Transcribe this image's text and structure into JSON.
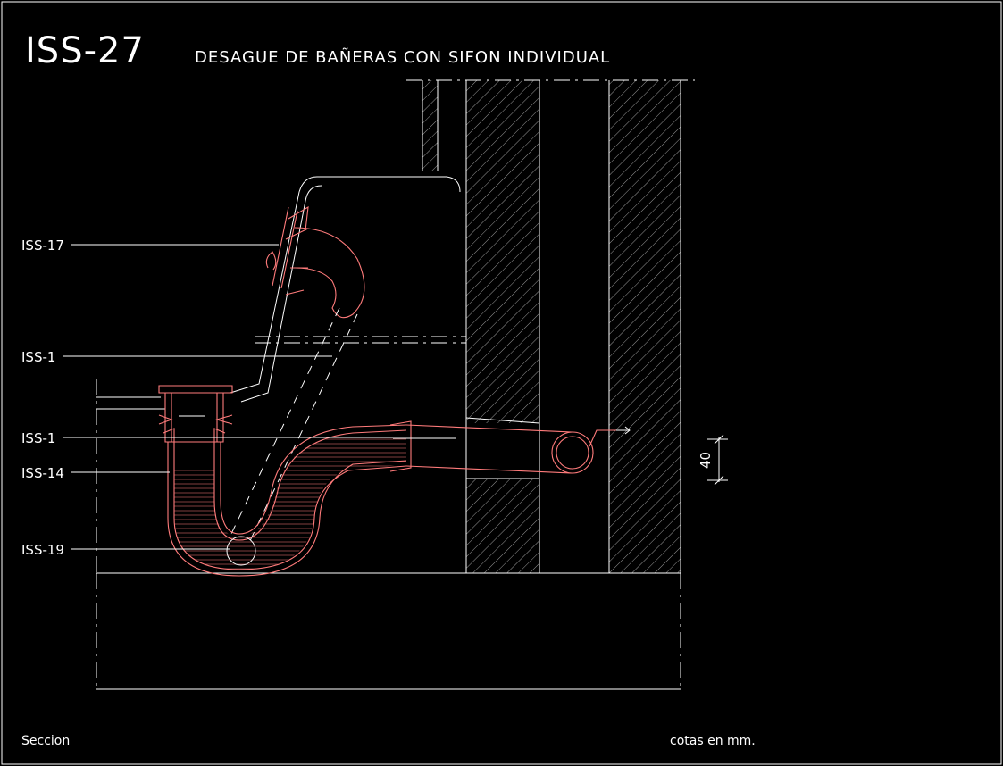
{
  "title_block": {
    "code": "ISS-27",
    "title": "DESAGUE DE BAÑERAS CON SIFON INDIVIDUAL"
  },
  "callouts": [
    {
      "label": "ISS-17"
    },
    {
      "label": "ISS-1"
    },
    {
      "label": "ISS-1"
    },
    {
      "label": "ISS-14"
    },
    {
      "label": "ISS-19"
    }
  ],
  "dimension": {
    "value": "40"
  },
  "footer": {
    "view": "Seccion",
    "units_note": "cotas en mm."
  },
  "colors": {
    "background": "#000000",
    "linework": "#ffffff",
    "pipe": "#ff7b7b"
  }
}
